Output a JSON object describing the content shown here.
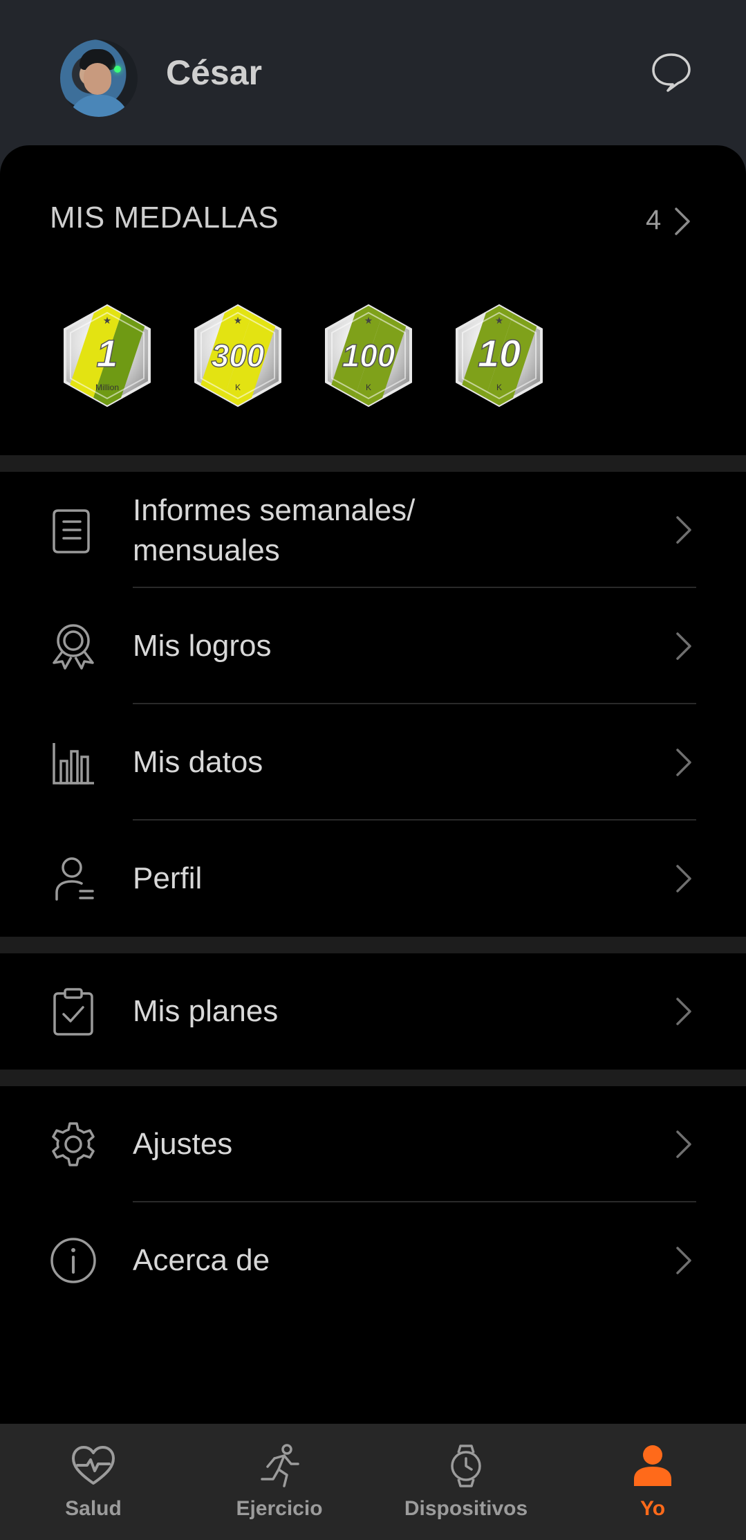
{
  "header": {
    "username": "César"
  },
  "medals": {
    "title": "MIS MEDALLAS",
    "count": "4",
    "items": [
      {
        "number": "1",
        "caption": "Million",
        "stripe": "#e3e312",
        "stripe2": "#6f9a14"
      },
      {
        "number": "300",
        "caption": "K",
        "stripe": "#e3e312",
        "stripe2": "#e3e312"
      },
      {
        "number": "100",
        "caption": "K",
        "stripe": "#7fa11a",
        "stripe2": "#7fa11a"
      },
      {
        "number": "10",
        "caption": "K",
        "stripe": "#7fa11a",
        "stripe2": "#7fa11a"
      }
    ]
  },
  "menu": {
    "group1": [
      {
        "line1": "Informes semanales/",
        "line2": "mensuales",
        "icon": "report-icon"
      },
      {
        "label": "Mis logros",
        "icon": "award-icon"
      },
      {
        "label": "Mis datos",
        "icon": "bar-chart-icon"
      },
      {
        "label": "Perfil",
        "icon": "profile-icon"
      }
    ],
    "group2": [
      {
        "label": "Mis planes",
        "icon": "clipboard-check-icon"
      }
    ],
    "group3": [
      {
        "label": "Ajustes",
        "icon": "gear-icon"
      },
      {
        "label": "Acerca de",
        "icon": "info-icon"
      }
    ]
  },
  "tabbar": {
    "tabs": [
      {
        "label": "Salud",
        "icon": "heart-pulse-icon",
        "active": false
      },
      {
        "label": "Ejercicio",
        "icon": "running-icon",
        "active": false
      },
      {
        "label": "Dispositivos",
        "icon": "watch-icon",
        "active": false
      },
      {
        "label": "Yo",
        "icon": "person-icon",
        "active": true
      }
    ]
  },
  "colors": {
    "accent": "#ff6a1a",
    "header_bg": "#23262c",
    "separator": "#1d1d1d",
    "tabbar_bg": "#272727"
  }
}
